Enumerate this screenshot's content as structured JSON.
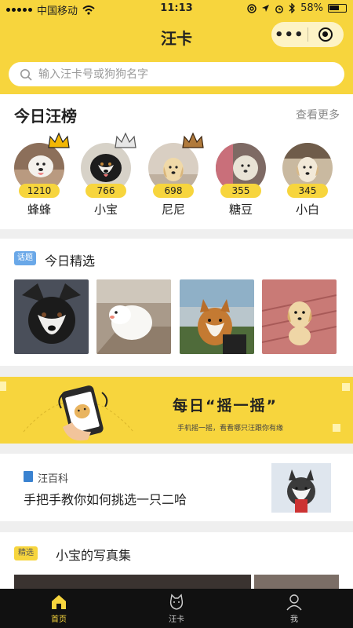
{
  "status": {
    "carrier": "中国移动",
    "time": "11:13",
    "battery": "58%"
  },
  "nav": {
    "title": "汪卡",
    "more_label": "•••"
  },
  "search": {
    "placeholder": "输入汪卡号或狗狗名字"
  },
  "ranking": {
    "title": "今日汪榜",
    "more": "查看更多",
    "items": [
      {
        "score": "1210",
        "name": "蜂蜂",
        "crown": "gold-crown-icon"
      },
      {
        "score": "766",
        "name": "小宝",
        "crown": "silver-crown-icon"
      },
      {
        "score": "698",
        "name": "尼尼",
        "crown": "bronze-crown-icon"
      },
      {
        "score": "355",
        "name": "糖豆"
      },
      {
        "score": "345",
        "name": "小白"
      }
    ]
  },
  "featured": {
    "tag": "话题",
    "title": "今日精选"
  },
  "banner": {
    "title": "每日“摇一摇”",
    "subtitle": "手机摇一摇，看看哪只汪跟你有缘"
  },
  "wiki": {
    "category": "汪百科",
    "title": "手把手教你如何挑选一只二哈"
  },
  "album": {
    "tag": "精选",
    "title": "小宝的写真集"
  },
  "tabs": [
    {
      "label": "首页",
      "icon": "home-icon",
      "active": true
    },
    {
      "label": "汪卡",
      "icon": "dog-face-icon",
      "active": false
    },
    {
      "label": "我",
      "icon": "user-icon",
      "active": false
    }
  ],
  "colors": {
    "brand_yellow": "#f7d53d",
    "tag_blue": "#6aa8e8",
    "tabbar": "#111111"
  }
}
